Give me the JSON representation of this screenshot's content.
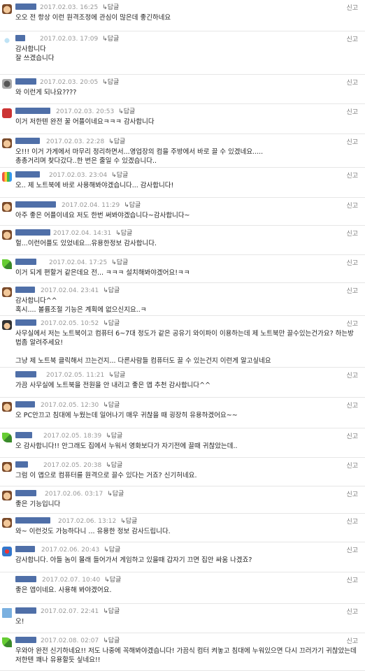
{
  "reply_label": "↳답글",
  "report_label": "신고",
  "comments": [
    {
      "date": "2017.02.03. 16:25",
      "text": "오오 전 항상 이런 원격조정에 관심이 많은데 좋긴하네요",
      "icon": "face"
    },
    {
      "date": "2017.02.03. 17:09",
      "text": "감사합니다\n잘 쓰겠습니다",
      "icon": "star"
    },
    {
      "date": "2017.02.03. 20:05",
      "text": "와 이런게 되나요????",
      "icon": "dark"
    },
    {
      "date": "2017.02.03. 20:53",
      "text": "이거 저한텐 완전 꿀 어플이네요ㅋㅋㅋ 감사합니다",
      "icon": "red"
    },
    {
      "date": "2017.02.03. 22:28",
      "text": "오!!! 이거 가게에서 마무리 정리하면서...영업장의 컴을 주방에서 바로 끌 수 있겠네요.....\n총총거리며 찾다갔다..한 번은 줄일 수 있겠습니다..",
      "icon": "face"
    },
    {
      "date": "2017.02.03. 23:04",
      "text": "오.. 제 노트북에 바로 사용해봐야겠습니다... 감사합니다!",
      "icon": "bars"
    },
    {
      "date": "2017.02.04. 11:29",
      "text": "아주 좋은 어플이네요 저도 한번 써봐야겠습니다~감사합니다~",
      "icon": "face"
    },
    {
      "date": "2017.02.04. 14:31",
      "text": "헐...이런어플도 있었네요...유용한정보 감사합니다.",
      "icon": "face"
    },
    {
      "date": "2017.02.04. 17:25",
      "text": "이거 되게 편할거 같은데요 전... ㅋㅋㅋ 설치해봐야겠어요!ㅋㅋ",
      "icon": "leaf"
    },
    {
      "date": "2017.02.04. 23:41",
      "text": "감사합니다^^\n혹시.... 볼륨조절 기능은 계획에 없으신지요..ㅋ",
      "icon": "face"
    },
    {
      "date": "2017.02.05. 10:52",
      "text": "사무실에서 저는 노트북이고 컴퓨터 6~7대 정도가 같은 공유기 와이파이 이용하는데 제 노트북만 끌수있는건가요? 하는방\n법좀 알려주세요!\n\n그냥 제 노트북 클릭해서 끄는건지... 다른사람들 컴퓨터도 끌 수 있는건지 이런게 알고싶네요",
      "icon": "hat"
    },
    {
      "date": "2017.02.05. 11:21",
      "text": "가끔 사무실에 노트북을 전원을 안 내리고 좋은 앱 추천 감사합니다^^",
      "icon": "none"
    },
    {
      "date": "2017.02.05. 12:30",
      "text": "오 PC안끄고 침대에 누웠는데 일어나기 매우 귀찮을 때 굉장히 유용하겠어요~~",
      "icon": "face"
    },
    {
      "date": "2017.02.05. 18:39",
      "text": "오 감사합니다!! 안그래도 집에서 누워서 영화보다가 자기전에 끌때 귀찮았는데..",
      "icon": "leaf"
    },
    {
      "date": "2017.02.05. 20:38",
      "text": "그럼 이 앱으로 컴퓨터를 원격으로 끌수 있다는 거죠? 신기허네요.",
      "icon": "face"
    },
    {
      "date": "2017.02.06. 03:17",
      "text": "좋은 기능입니다",
      "icon": "face"
    },
    {
      "date": "2017.02.06. 13:12",
      "text": "와~ 이런것도 가능하다니 ... 유용한 정보 감사드립니다.",
      "icon": "face"
    },
    {
      "date": "2017.02.06. 20:43",
      "text": "감사합니다. 아들 놈이 몰래 들어가서 게임하고 있을때 갑자기 끄면 집안 싸움 나겠죠?",
      "icon": "clown"
    },
    {
      "date": "2017.02.07. 10:40",
      "text": "좋은 앱이네요. 사용해 봐야겠어요.",
      "icon": "none"
    },
    {
      "date": "2017.02.07. 22:41",
      "text": "오!",
      "icon": "folder"
    },
    {
      "date": "2017.02.08. 02:07",
      "text": "우와아 완전 신기하네요!! 저도 나중에 꼭해봐야겠습니다! 가끔식 컴터 켜놓고 침대에 누워있으면 다시 끄러가기 귀찮았는데\n저한텐 꽤나 유용할듯 싶네요!!",
      "icon": "leaf"
    }
  ]
}
